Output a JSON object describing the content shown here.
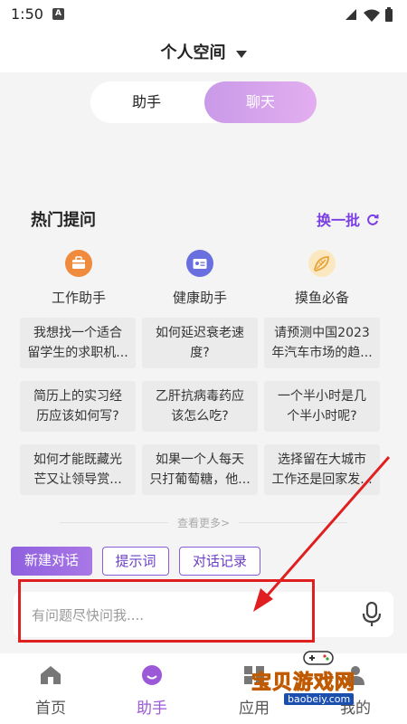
{
  "status_bar": {
    "time": "1:50",
    "notification_letter": "A"
  },
  "header": {
    "title": "个人空间"
  },
  "mode_switch": {
    "options": [
      "助手",
      "聊天"
    ],
    "selected": "聊天"
  },
  "hot_questions": {
    "title": "热门提问",
    "refresh_label": "换一批",
    "categories": [
      {
        "label": "工作助手",
        "icon": "briefcase-icon",
        "color": "#f08a3c"
      },
      {
        "label": "健康助手",
        "icon": "id-card-icon",
        "color": "#6a6fe0"
      },
      {
        "label": "摸鱼必备",
        "icon": "fish-icon",
        "color": "#f3c872"
      }
    ],
    "cards": [
      [
        "我想找一个适合",
        "留学生的求职机..."
      ],
      [
        "如何延迟衰老速",
        "度?"
      ],
      [
        "请预测中国2023",
        "年汽车市场的趋..."
      ],
      [
        "简历上的实习经",
        "历应该如何写?"
      ],
      [
        "乙肝抗病毒药应",
        "该怎么吃?"
      ],
      [
        "一个半小时是几",
        "个半小时呢?"
      ],
      [
        "如何才能既藏光",
        "芒又让领导赏..."
      ],
      [
        "如果一个人每天",
        "只打葡萄糖，他..."
      ],
      [
        "选择留在大城市",
        "工作还是回家发..."
      ]
    ],
    "see_more": "查看更多>"
  },
  "actions": {
    "new_chat": "新建对话",
    "prompts": "提示词",
    "history": "对话记录"
  },
  "input": {
    "placeholder": "有问题尽快问我...."
  },
  "tabbar": {
    "items": [
      {
        "label": "首页",
        "icon": "home-icon",
        "active": false
      },
      {
        "label": "助手",
        "icon": "assistant-icon",
        "active": true
      },
      {
        "label": "应用",
        "icon": "apps-icon",
        "active": false
      },
      {
        "label": "我的",
        "icon": "profile-icon",
        "active": false
      }
    ]
  },
  "watermark": {
    "text": "宝贝游戏网",
    "url": "baobeiy.com"
  },
  "colors": {
    "accent": "#9b59d8",
    "annotation": "#e02020",
    "background": "#f4f4f4"
  }
}
